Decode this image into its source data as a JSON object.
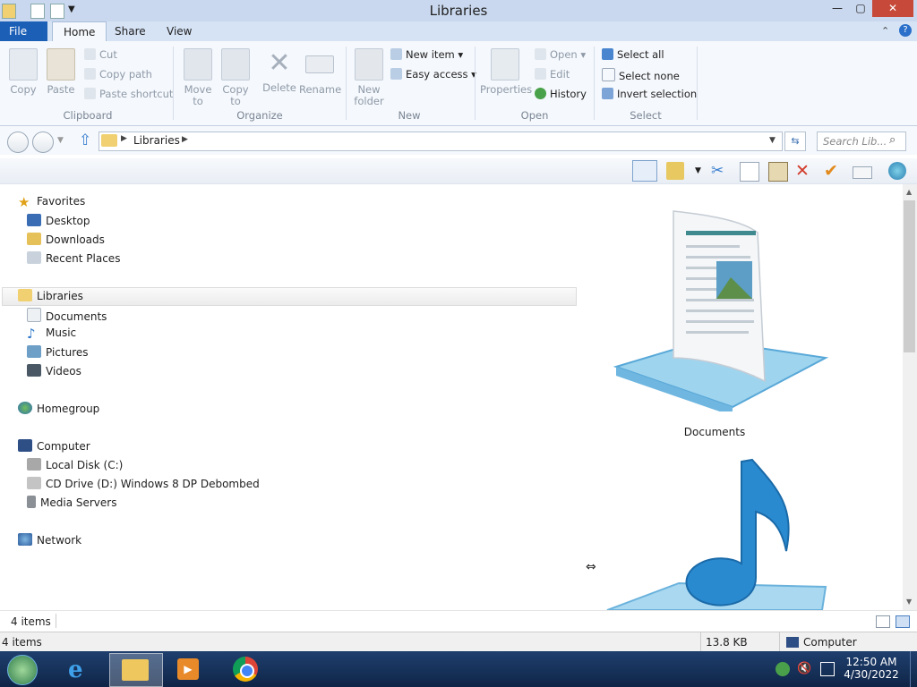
{
  "window": {
    "title": "Libraries",
    "controls": {
      "minimize": "—",
      "maximize": "▢",
      "close": "✕"
    }
  },
  "ribbon_tabs": [
    "File",
    "Home",
    "Share",
    "View"
  ],
  "ribbon": {
    "clipboard": {
      "copy": "Copy",
      "paste": "Paste",
      "cut": "Cut",
      "copy_path": "Copy path",
      "paste_shortcut": "Paste shortcut",
      "label": "Clipboard"
    },
    "organize": {
      "move_to": "Move to",
      "copy_to": "Copy to",
      "delete": "Delete",
      "rename": "Rename",
      "label": "Organize"
    },
    "new": {
      "new_folder": "New folder",
      "new_item": "New item",
      "easy_access": "Easy access",
      "label": "New"
    },
    "open": {
      "properties": "Properties",
      "open": "Open",
      "edit": "Edit",
      "history": "History",
      "label": "Open"
    },
    "select": {
      "select_all": "Select all",
      "select_none": "Select none",
      "invert": "Invert selection",
      "label": "Select"
    }
  },
  "address": {
    "crumb": "Libraries",
    "search_placeholder": "Search Lib..."
  },
  "nav": {
    "favorites": {
      "label": "Favorites",
      "items": [
        "Desktop",
        "Downloads",
        "Recent Places"
      ]
    },
    "libraries": {
      "label": "Libraries",
      "items": [
        "Documents",
        "Music",
        "Pictures",
        "Videos"
      ]
    },
    "homegroup": "Homegroup",
    "computer": {
      "label": "Computer",
      "items": [
        "Local Disk (C:)",
        "CD Drive (D:) Windows 8 DP Debombed",
        "Media Servers"
      ]
    },
    "network": "Network"
  },
  "content": {
    "items": [
      "Documents"
    ]
  },
  "status": {
    "items_count": "4 items",
    "bottom_items": "4 items",
    "size": "13.8 KB",
    "location": "Computer"
  },
  "tray": {
    "time": "12:50 AM",
    "date": "4/30/2022"
  },
  "colors": {
    "file_tab": "#1c5fb6",
    "taskbar": "#1f3f6e"
  }
}
